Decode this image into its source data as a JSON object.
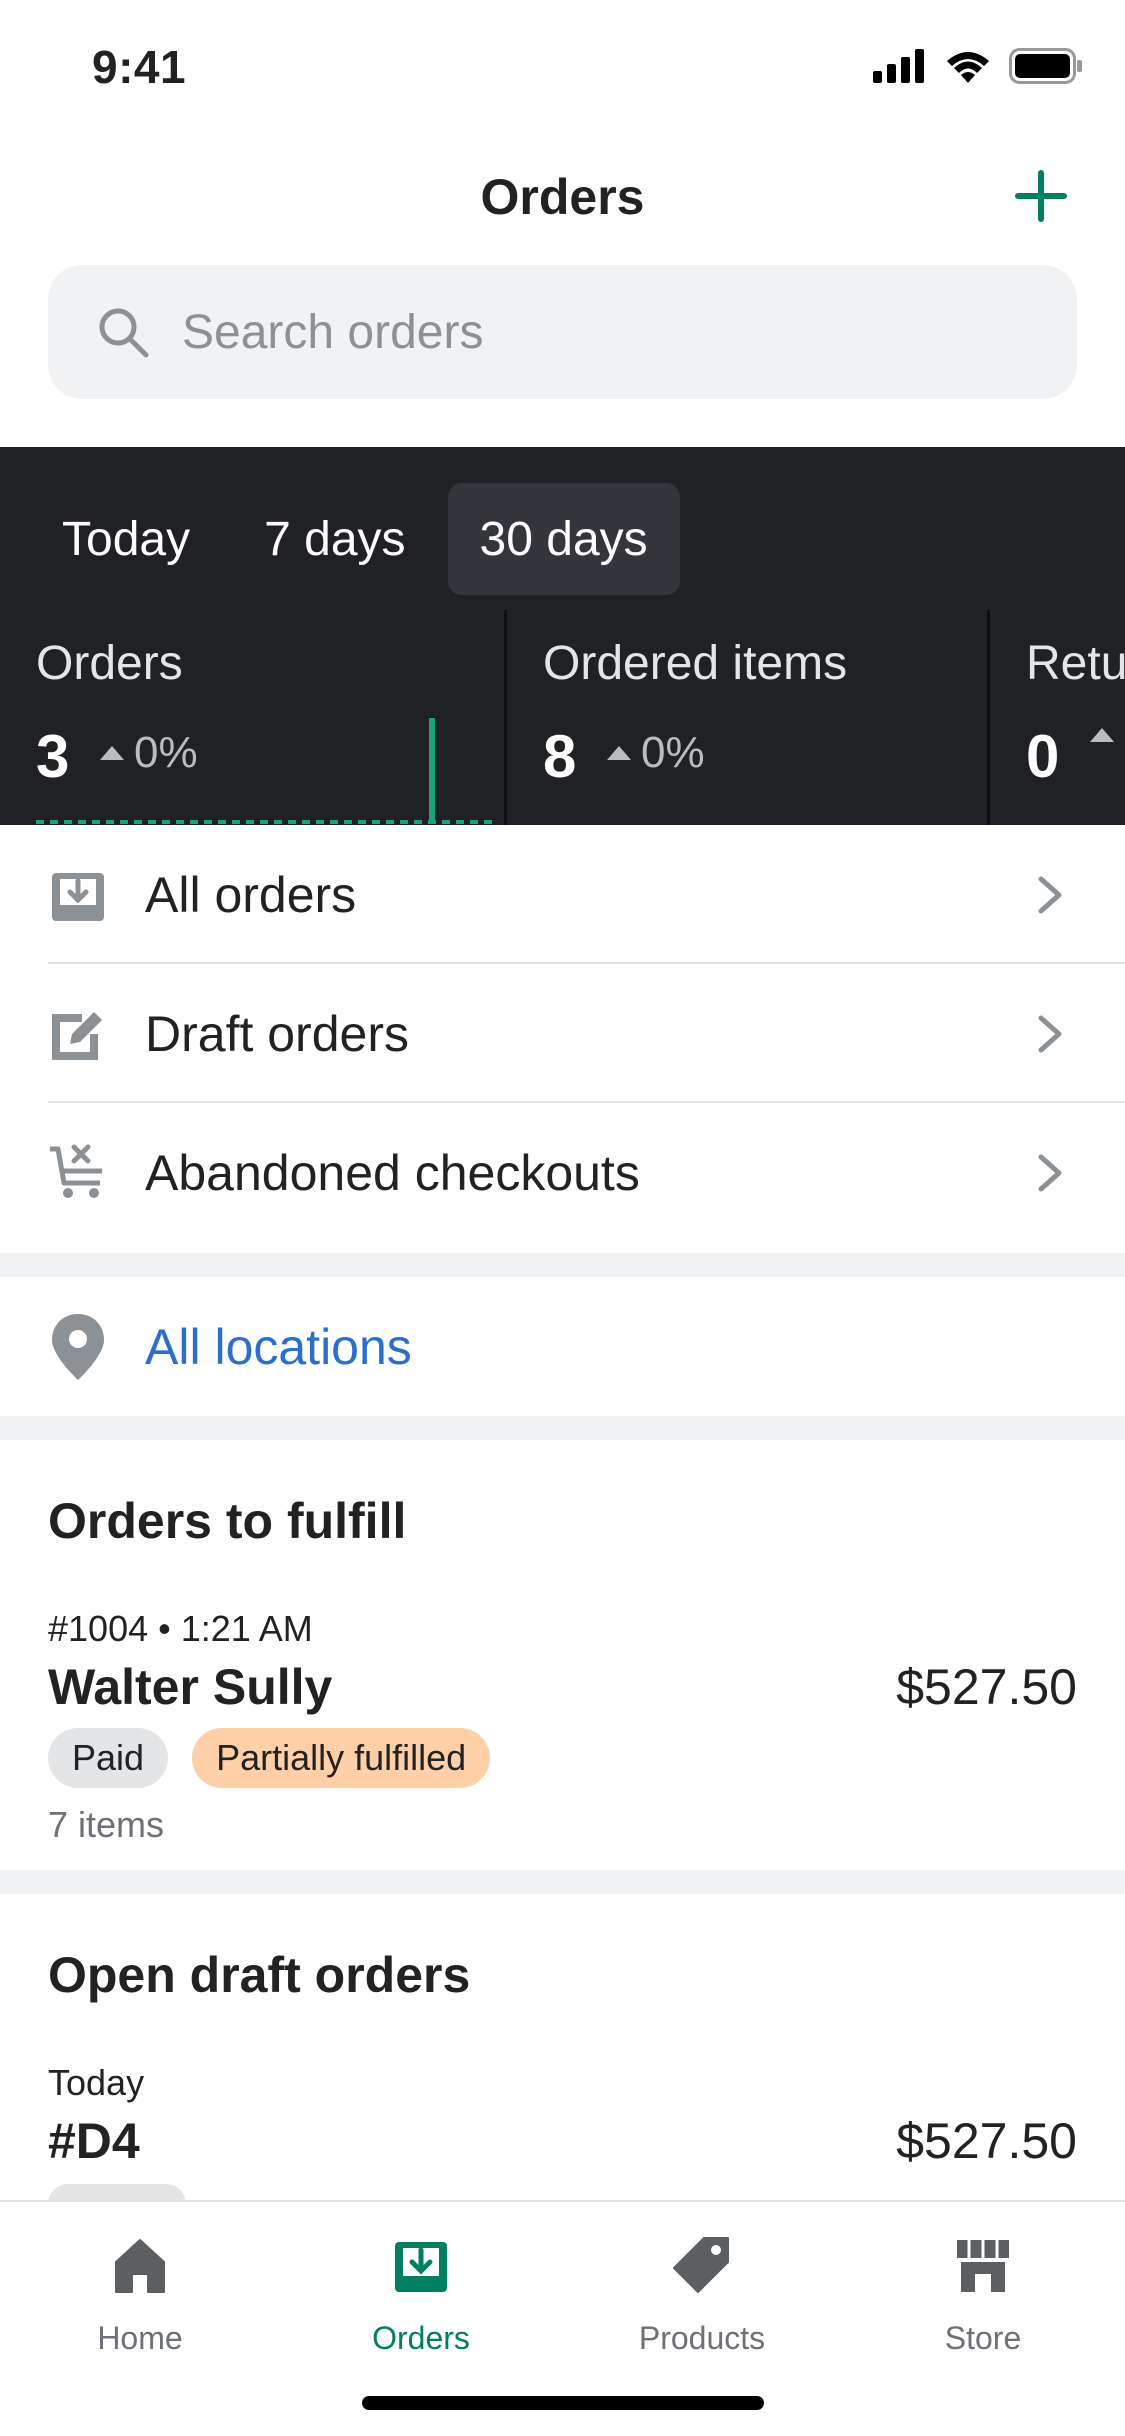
{
  "status_bar": {
    "time": "9:41"
  },
  "header": {
    "title": "Orders"
  },
  "search": {
    "placeholder": "Search orders"
  },
  "analytics": {
    "periods": [
      "Today",
      "7 days",
      "30 days"
    ],
    "active_period": "30 days",
    "metrics": [
      {
        "label": "Orders",
        "value": "3",
        "change": "0%"
      },
      {
        "label": "Ordered items",
        "value": "8",
        "change": "0%"
      },
      {
        "label": "Retu",
        "value": "0",
        "change": ""
      }
    ]
  },
  "nav_rows": [
    {
      "label": "All orders",
      "icon": "inbox-download-icon"
    },
    {
      "label": "Draft orders",
      "icon": "edit-document-icon"
    },
    {
      "label": "Abandoned checkouts",
      "icon": "cart-cancel-icon"
    }
  ],
  "location": {
    "label": "All locations",
    "icon": "location-pin-icon"
  },
  "orders_to_fulfill": {
    "title": "Orders to fulfill",
    "order": {
      "meta": "#1004 • 1:21 AM",
      "customer": "Walter Sully",
      "amount": "$527.50",
      "badges": [
        "Paid",
        "Partially fulfilled"
      ],
      "items": "7 items"
    }
  },
  "open_draft_orders": {
    "title": "Open draft orders",
    "order": {
      "meta": "Today",
      "name": "#D4",
      "amount": "$527.50"
    }
  },
  "tab_bar": {
    "tabs": [
      {
        "label": "Home",
        "icon": "home-icon"
      },
      {
        "label": "Orders",
        "icon": "orders-icon"
      },
      {
        "label": "Products",
        "icon": "tag-icon"
      },
      {
        "label": "Store",
        "icon": "store-icon"
      }
    ],
    "active": "Orders"
  },
  "colors": {
    "accent": "#008060",
    "link": "#2c6ecb",
    "analytics_bg": "#202124",
    "badge_partial": "#ffd0a8",
    "badge_paid": "#e4e5e7"
  }
}
